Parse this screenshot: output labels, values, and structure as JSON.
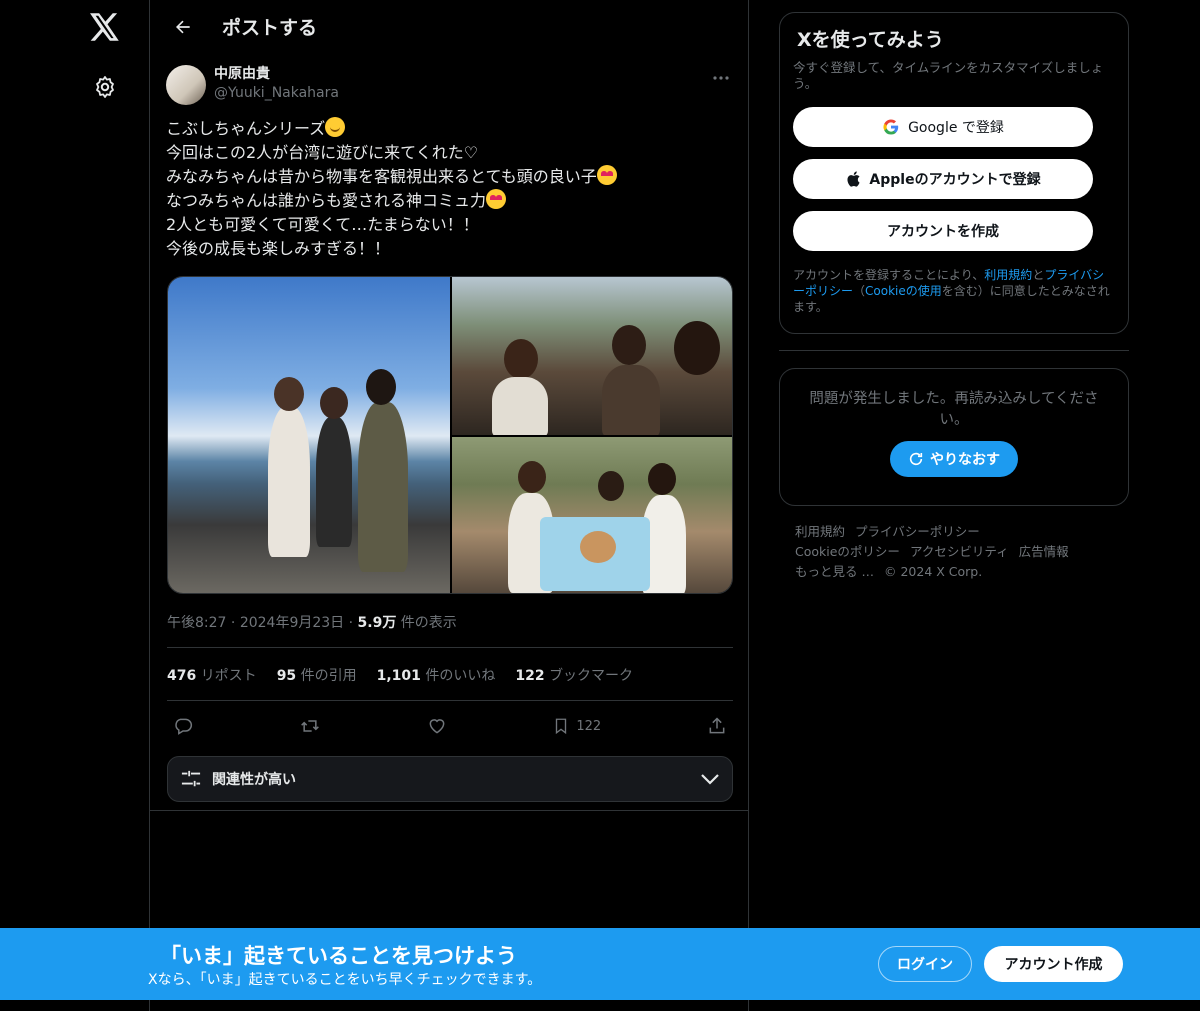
{
  "nav": {
    "logo_icon": "x-logo-icon",
    "settings_icon": "gear-icon"
  },
  "header": {
    "title": "ポストする"
  },
  "tweet": {
    "display_name": "中原由貴",
    "handle": "@Yuuki_Nakahara",
    "lines": [
      "こぶしちゃんシリーズ",
      "今回はこの2人が台湾に遊びに来てくれた♡",
      "みなみちゃんは昔から物事を客観視出来るとても頭の良い子",
      "なつみちゃんは誰からも愛される神コミュ力",
      "2人とも可愛くて可愛くて…たまらない！！",
      "今後の成長も楽しみすぎる！！"
    ],
    "time": "午後8:27",
    "date": "2024年9月23日",
    "views_count": "5.9万",
    "views_label": "件の表示",
    "stats": {
      "reposts": "476",
      "reposts_label": "リポスト",
      "quotes": "95",
      "quotes_label": "件の引用",
      "likes": "1,101",
      "likes_label": "件のいいね",
      "bookmarks": "122",
      "bookmarks_label": "ブックマーク"
    },
    "bookmark_action_count": "122",
    "sort_label": "関連性が高い"
  },
  "signup": {
    "title": "Xを使ってみよう",
    "subtitle": "今すぐ登録して、タイムラインをカスタマイズしましょう。",
    "google_label": "Google で登録",
    "apple_label": "Appleのアカウントで登録",
    "create_label": "アカウントを作成",
    "legal_pre": "アカウントを登録することにより、",
    "legal_terms": "利用規約",
    "legal_and": "と",
    "legal_privacy": "プライバシーポリシー",
    "legal_mid": "（",
    "legal_cookie": "Cookieの使用",
    "legal_post": "を含む）に同意したとみなされます。"
  },
  "error": {
    "message": "問題が発生しました。再読み込みしてください。",
    "retry_label": "やりなおす"
  },
  "footer": {
    "links": [
      "利用規約",
      "プライバシーポリシー",
      "Cookieのポリシー",
      "アクセシビリティ",
      "広告情報",
      "もっと見る …"
    ],
    "copyright": "© 2024 X Corp."
  },
  "banner": {
    "title": "「いま」起きていることを見つけよう",
    "subtitle": "Xなら、「いま」起きていることをいち早くチェックできます。",
    "login_label": "ログイン",
    "signup_label": "アカウント作成"
  },
  "colors": {
    "accent": "#1d9bf0",
    "background": "#000000",
    "muted": "#71767b",
    "border": "#2f3336"
  }
}
